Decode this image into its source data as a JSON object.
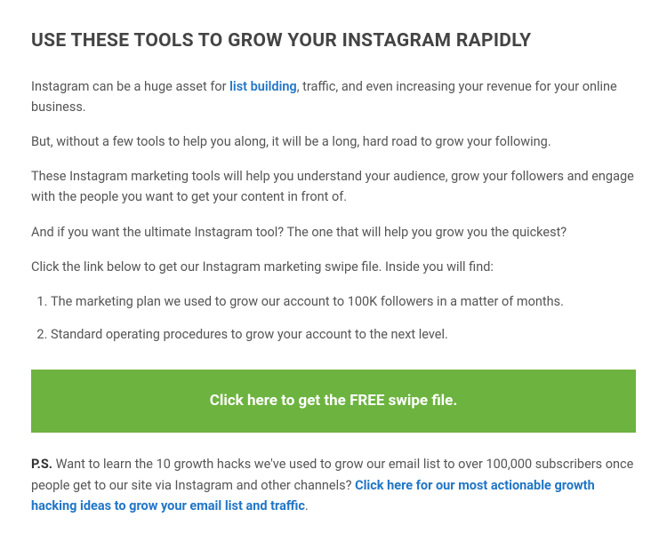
{
  "heading": "USE THESE TOOLS TO GROW YOUR INSTAGRAM RAPIDLY",
  "p1_a": "Instagram can be a huge asset for ",
  "p1_link": "list building",
  "p1_b": ", traffic, and even increasing your revenue for your online business.",
  "p2": "But, without a few tools to help you along, it will be a long, hard road to grow your following.",
  "p3": "These Instagram marketing tools will help you understand your audience, grow your followers and engage with the people you want to get your content in front of.",
  "p4": "And if you want the ultimate Instagram tool? The one that will help you grow you the quickest?",
  "p5": "Click the link below to get our Instagram marketing swipe file. Inside you will find:",
  "list": {
    "item1": "The marketing plan we used to grow our account to 100K followers in a matter of months.",
    "item2": "Standard operating procedures to grow your account to the next level."
  },
  "cta_label": "Click here to get the FREE swipe file.",
  "ps_prefix": "P.S.",
  "ps_body": " Want to learn the 10 growth hacks we've used to grow our email list to over 100,000 subscribers once people get to our site via Instagram and other channels? ",
  "ps_link": "Click here for our most actionable growth hacking ideas to grow your email list and traffic",
  "ps_suffix": "."
}
